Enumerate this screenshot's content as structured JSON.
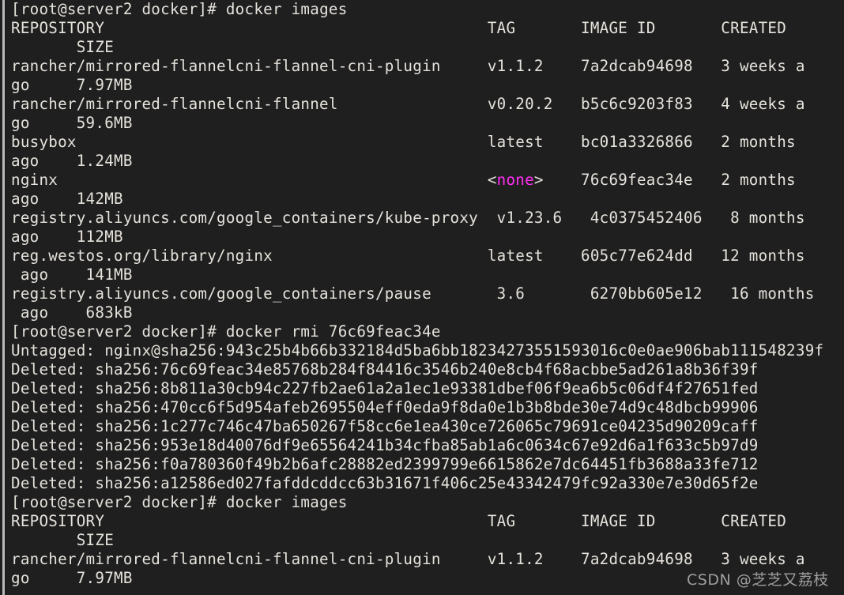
{
  "terminal": {
    "title": "docker images",
    "background_color": "#1f1f1f",
    "foreground_color": "#e6e2dc",
    "accent_color": "#ff2ff2",
    "prompt": "[root@server2 docker]#",
    "hostname": "server2",
    "user": "root",
    "cwd": "docker",
    "scrollbar": "vertical-scrollbar"
  },
  "watermark": {
    "text": "CSDN @芝芝又荔枝"
  },
  "commands": [
    {
      "prompt": "[root@server2 docker]#",
      "command": " docker images"
    },
    {
      "prompt": "[root@server2 docker]#",
      "command": " docker rmi 76c69feac34e"
    },
    {
      "prompt": "[root@server2 docker]#",
      "command": " docker images"
    }
  ],
  "images_table": {
    "headers": [
      "REPOSITORY",
      "TAG",
      "IMAGE ID",
      "CREATED",
      "SIZE"
    ],
    "rows": [
      {
        "repository": "rancher/mirrored-flannelcni-flannel-cni-plugin",
        "tag": "v1.1.2",
        "image_id": "7a2dcab94698",
        "created": "3 weeks ago",
        "size": "7.97MB"
      },
      {
        "repository": "rancher/mirrored-flannelcni-flannel",
        "tag": "v0.20.2",
        "image_id": "b5c6c9203f83",
        "created": "4 weeks ago",
        "size": "59.6MB"
      },
      {
        "repository": "busybox",
        "tag": "latest",
        "image_id": "bc01a3326866",
        "created": "2 months ago",
        "size": "1.24MB"
      },
      {
        "repository": "nginx",
        "tag": "<none>",
        "tag_highlight": true,
        "image_id": "76c69feac34e",
        "created": "2 months ago",
        "size": "142MB"
      },
      {
        "repository": "registry.aliyuncs.com/google_containers/kube-proxy",
        "tag": "v1.23.6",
        "image_id": "4c0375452406",
        "created": "8 months ago",
        "size": "112MB"
      },
      {
        "repository": "reg.westos.org/library/nginx",
        "tag": "latest",
        "image_id": "605c77e624dd",
        "created": "12 months ago",
        "size": "141MB"
      },
      {
        "repository": "registry.aliyuncs.com/google_containers/pause",
        "tag": "3.6",
        "image_id": "6270bb605e12",
        "created": "16 months ago",
        "size": "683kB"
      }
    ]
  },
  "rmi_output": {
    "untagged": "Untagged: nginx@sha256:943c25b4b66b332184d5ba6bb18234273551593016c0e0ae906bab111548239f",
    "deleted": [
      "Deleted: sha256:76c69feac34e85768b284f84416c3546b240e8cb4f68acbbe5ad261a8b36f39f",
      "Deleted: sha256:8b811a30cb94c227fb2ae61a2a1ec1e93381dbef06f9ea6b5c06df4f27651fed",
      "Deleted: sha256:470cc6f5d954afeb2695504eff0eda9f8da0e1b3b8bde30e74d9c48dbcb99906",
      "Deleted: sha256:1c277c746c47ba650267f58cc6e1ea430ce726065c79691ce04235d90209caff",
      "Deleted: sha256:953e18d40076df9e65564241b34cfba85ab1a6c0634c67e92d6a1f633c5b97d9",
      "Deleted: sha256:f0a780360f49b2b6afc28882ed2399799e6615862e7dc64451fb3688a33fe712",
      "Deleted: sha256:a12586ed027fafddcddcc63b31671f406c25e43342479fc92a330e7e30d65f2e"
    ]
  },
  "lines": [
    {
      "id": "line-1",
      "type": "prompt",
      "prompt": "[root@server2 docker]#",
      "rest": " docker images"
    },
    {
      "id": "line-2",
      "type": "output",
      "text": "REPOSITORY                                         TAG       IMAGE ID       CREATED"
    },
    {
      "id": "line-3",
      "type": "output",
      "text": "       SIZE"
    },
    {
      "id": "line-4",
      "type": "output",
      "text": "rancher/mirrored-flannelcni-flannel-cni-plugin     v1.1.2    7a2dcab94698   3 weeks a"
    },
    {
      "id": "line-5",
      "type": "output",
      "text": "go     7.97MB"
    },
    {
      "id": "line-6",
      "type": "output",
      "text": "rancher/mirrored-flannelcni-flannel                v0.20.2   b5c6c9203f83   4 weeks a"
    },
    {
      "id": "line-7",
      "type": "output",
      "text": "go     59.6MB"
    },
    {
      "id": "line-8",
      "type": "output",
      "text": "busybox                                            latest    bc01a3326866   2 months "
    },
    {
      "id": "line-9",
      "type": "output",
      "text": "ago    1.24MB"
    },
    {
      "id": "line-10",
      "type": "tagnone",
      "pre": "nginx                                              <",
      "mid": "none",
      "post": ">    76c69feac34e   2 months "
    },
    {
      "id": "line-11",
      "type": "output",
      "text": "ago    142MB"
    },
    {
      "id": "line-12",
      "type": "output",
      "text": "registry.aliyuncs.com/google_containers/kube-proxy  v1.23.6   4c0375452406   8 months "
    },
    {
      "id": "line-13",
      "type": "output",
      "text": "ago    112MB"
    },
    {
      "id": "line-14",
      "type": "output",
      "text": "reg.westos.org/library/nginx                       latest    605c77e624dd   12 months"
    },
    {
      "id": "line-15",
      "type": "output",
      "text": " ago    141MB"
    },
    {
      "id": "line-16",
      "type": "output",
      "text": "registry.aliyuncs.com/google_containers/pause       3.6       6270bb605e12   16 months"
    },
    {
      "id": "line-17",
      "type": "output",
      "text": " ago    683kB"
    },
    {
      "id": "line-18",
      "type": "prompt",
      "prompt": "[root@server2 docker]#",
      "rest": " docker rmi 76c69feac34e"
    },
    {
      "id": "line-19",
      "type": "output",
      "text": "Untagged: nginx@sha256:943c25b4b66b332184d5ba6bb18234273551593016c0e0ae906bab111548239f"
    },
    {
      "id": "line-20",
      "type": "output",
      "text": "Deleted: sha256:76c69feac34e85768b284f84416c3546b240e8cb4f68acbbe5ad261a8b36f39f"
    },
    {
      "id": "line-21",
      "type": "output",
      "text": "Deleted: sha256:8b811a30cb94c227fb2ae61a2a1ec1e93381dbef06f9ea6b5c06df4f27651fed"
    },
    {
      "id": "line-22",
      "type": "output",
      "text": "Deleted: sha256:470cc6f5d954afeb2695504eff0eda9f8da0e1b3b8bde30e74d9c48dbcb99906"
    },
    {
      "id": "line-23",
      "type": "output",
      "text": "Deleted: sha256:1c277c746c47ba650267f58cc6e1ea430ce726065c79691ce04235d90209caff"
    },
    {
      "id": "line-24",
      "type": "output",
      "text": "Deleted: sha256:953e18d40076df9e65564241b34cfba85ab1a6c0634c67e92d6a1f633c5b97d9"
    },
    {
      "id": "line-25",
      "type": "output",
      "text": "Deleted: sha256:f0a780360f49b2b6afc28882ed2399799e6615862e7dc64451fb3688a33fe712"
    },
    {
      "id": "line-26",
      "type": "output",
      "text": "Deleted: sha256:a12586ed027fafddcddcc63b31671f406c25e43342479fc92a330e7e30d65f2e"
    },
    {
      "id": "line-27",
      "type": "prompt",
      "prompt": "[root@server2 docker]#",
      "rest": " docker images"
    },
    {
      "id": "line-28",
      "type": "output",
      "text": "REPOSITORY                                         TAG       IMAGE ID       CREATED"
    },
    {
      "id": "line-29",
      "type": "output",
      "text": "       SIZE"
    },
    {
      "id": "line-30",
      "type": "output",
      "text": "rancher/mirrored-flannelcni-flannel-cni-plugin     v1.1.2    7a2dcab94698   3 weeks a"
    },
    {
      "id": "line-31",
      "type": "output",
      "text": "go     7.97MB"
    }
  ]
}
